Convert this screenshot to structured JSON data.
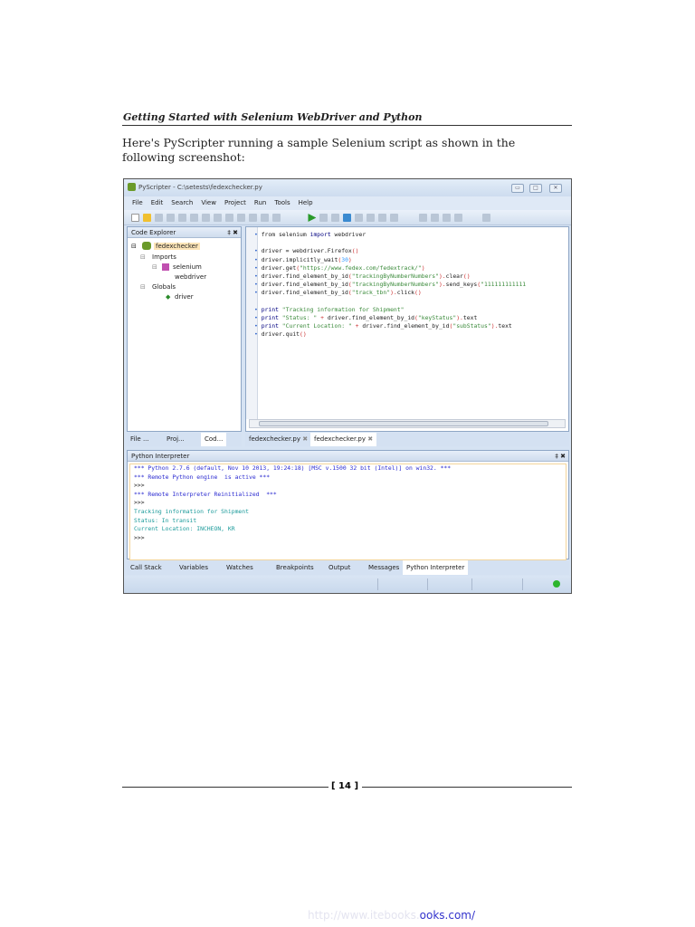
{
  "page": {
    "header": "Getting Started with Selenium WebDriver and Python",
    "paragraph": "Here's PyScripter running a sample Selenium script as shown in the following screenshot:",
    "page_number": "[ 14 ]",
    "link_faint": "http://www.itebooks.",
    "link_visible": "ooks.com/"
  },
  "app": {
    "title": "PyScripter - C:\\setests\\fedexchecker.py",
    "menu": [
      "File",
      "Edit",
      "Search",
      "View",
      "Project",
      "Run",
      "Tools",
      "Help"
    ],
    "code_explorer": {
      "title": "Code Explorer",
      "pin": "‡ ✖",
      "tree": [
        "fedexchecker",
        "Imports",
        "selenium",
        "webdriver",
        "Globals",
        "driver"
      ],
      "tabs": [
        "File ...",
        "Proj...",
        "Cod..."
      ]
    },
    "editor": {
      "lines": [
        [
          {
            "t": "from ",
            "c": "#222"
          },
          {
            "t": "selenium ",
            "c": "#222"
          },
          {
            "t": "import",
            "c": "#000080"
          },
          {
            "t": " webdriver",
            "c": "#222"
          }
        ],
        [],
        [
          {
            "t": "driver = webdriver.Firefox",
            "c": "#222"
          },
          {
            "t": "()",
            "c": "#cc3333"
          }
        ],
        [
          {
            "t": "driver.implicitly_wait",
            "c": "#222"
          },
          {
            "t": "(",
            "c": "#cc3333"
          },
          {
            "t": "30",
            "c": "#3399ff"
          },
          {
            "t": ")",
            "c": "#cc3333"
          }
        ],
        [
          {
            "t": "driver.get",
            "c": "#222"
          },
          {
            "t": "(",
            "c": "#cc3333"
          },
          {
            "t": "\"https://www.fedex.com/fedextrack/\"",
            "c": "#3a8a3a"
          },
          {
            "t": ")",
            "c": "#cc3333"
          }
        ],
        [
          {
            "t": "driver.find_element_by_id",
            "c": "#222"
          },
          {
            "t": "(",
            "c": "#cc3333"
          },
          {
            "t": "\"trackingByNumberNumbers\"",
            "c": "#3a8a3a"
          },
          {
            "t": ").",
            "c": "#cc3333"
          },
          {
            "t": "clear",
            "c": "#222"
          },
          {
            "t": "()",
            "c": "#cc3333"
          }
        ],
        [
          {
            "t": "driver.find_element_by_id",
            "c": "#222"
          },
          {
            "t": "(",
            "c": "#cc3333"
          },
          {
            "t": "\"trackingByNumberNumbers\"",
            "c": "#3a8a3a"
          },
          {
            "t": ").",
            "c": "#cc3333"
          },
          {
            "t": "send_keys",
            "c": "#222"
          },
          {
            "t": "(",
            "c": "#cc3333"
          },
          {
            "t": "\"111111111111",
            "c": "#3a8a3a"
          }
        ],
        [
          {
            "t": "driver.find_element_by_id",
            "c": "#222"
          },
          {
            "t": "(",
            "c": "#cc3333"
          },
          {
            "t": "\"track_tbn\"",
            "c": "#3a8a3a"
          },
          {
            "t": ").",
            "c": "#cc3333"
          },
          {
            "t": "click",
            "c": "#222"
          },
          {
            "t": "()",
            "c": "#cc3333"
          }
        ],
        [],
        [
          {
            "t": "print ",
            "c": "#000080"
          },
          {
            "t": "\"Tracking information for Shipment\"",
            "c": "#3a8a3a"
          }
        ],
        [
          {
            "t": "print ",
            "c": "#000080"
          },
          {
            "t": "\"Status: \" ",
            "c": "#3a8a3a"
          },
          {
            "t": "+ ",
            "c": "#cc3333"
          },
          {
            "t": "driver.find_element_by_id",
            "c": "#222"
          },
          {
            "t": "(",
            "c": "#cc3333"
          },
          {
            "t": "\"keyStatus\"",
            "c": "#3a8a3a"
          },
          {
            "t": ").",
            "c": "#cc3333"
          },
          {
            "t": "text",
            "c": "#222"
          }
        ],
        [
          {
            "t": "print ",
            "c": "#000080"
          },
          {
            "t": "\"Current Location: \" ",
            "c": "#3a8a3a"
          },
          {
            "t": "+ ",
            "c": "#cc3333"
          },
          {
            "t": "driver.find_element_by_id",
            "c": "#222"
          },
          {
            "t": "(",
            "c": "#cc3333"
          },
          {
            "t": "\"subStatus\"",
            "c": "#3a8a3a"
          },
          {
            "t": ").",
            "c": "#cc3333"
          },
          {
            "t": "text",
            "c": "#222"
          }
        ],
        [
          {
            "t": "driver.quit",
            "c": "#222"
          },
          {
            "t": "()",
            "c": "#cc3333"
          }
        ]
      ],
      "tabs": [
        "fedexchecker.py",
        "fedexchecker.py"
      ],
      "tab_close": "✖"
    },
    "interpreter": {
      "title": "Python Interpreter",
      "pin": "‡ ✖",
      "lines": [
        {
          "t": "*** Python 2.7.6 (default, Nov 10 2013, 19:24:18) [MSC v.1500 32 bit (Intel)] on win32. ***",
          "c": "#2a2ad0"
        },
        {
          "t": "*** Remote Python engine  is active ***",
          "c": "#2a2ad0"
        },
        {
          "t": ">>>",
          "c": "#222"
        },
        {
          "t": "*** Remote Interpreter Reinitialized  ***",
          "c": "#2a2ad0"
        },
        {
          "t": ">>>",
          "c": "#222"
        },
        {
          "t": "Tracking information for Shipment",
          "c": "#1a9a9a"
        },
        {
          "t": "Status: In transit",
          "c": "#1a9a9a"
        },
        {
          "t": "Current Location: INCHEON, KR",
          "c": "#1a9a9a"
        },
        {
          "t": ">>>",
          "c": "#222"
        }
      ]
    },
    "bottom_tabs": [
      "Call Stack",
      "Variables",
      "Watches",
      "Breakpoints",
      "Output",
      "Messages",
      "Python Interpreter"
    ],
    "status_led_color": "#2db52d"
  }
}
